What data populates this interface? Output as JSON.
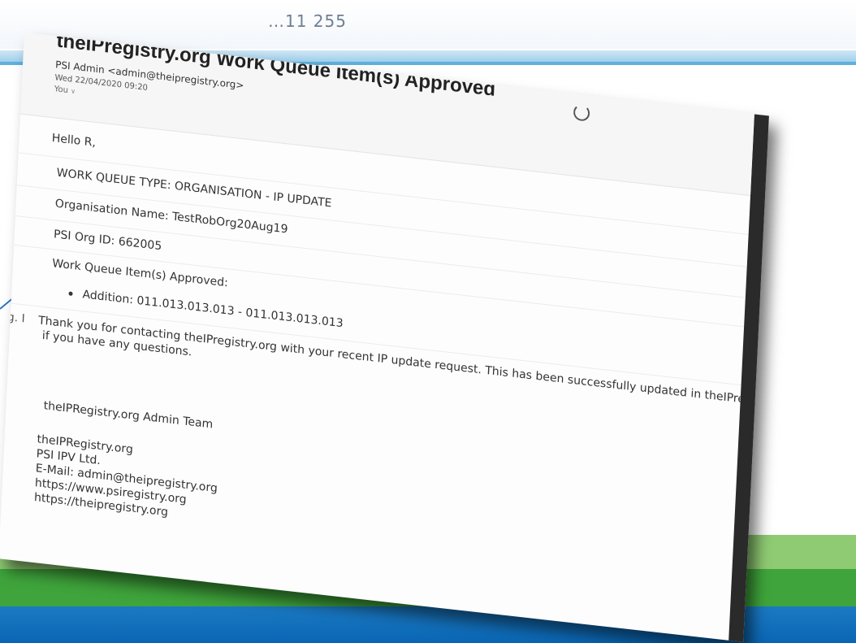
{
  "background": {
    "behind_title": "…11 255"
  },
  "email": {
    "subject": "theIPregistry.org Work Queue Item(s) Approved",
    "sender": "PSI Admin <admin@theipregistry.org>",
    "date": "Wed 22/04/2020 09:20",
    "recipient": "You",
    "greeting": "Hello R,",
    "queue_type": "WORK QUEUE TYPE: ORGANISATION - IP UPDATE",
    "org_name": "Organisation Name: TestRobOrg20Aug19",
    "org_id": "PSI Org ID: 662005",
    "approved_heading": "Work Queue Item(s) Approved:",
    "approved_items": [
      "Addition: 011.013.013.013 - 011.013.013.013"
    ],
    "cut_prefix": "g. I",
    "thank_you_line1": "Thank you for contacting theIPregistry.org with your recent IP update request. This has been successfully updated in theIPregistry.or",
    "thank_you_line2": "if you have any questions.",
    "signoff": "theIPRegistry.org Admin Team",
    "signature": {
      "org": "theIPRegistry.org",
      "company": "PSI IPV Ltd.",
      "email": "E-Mail: admin@theipregistry.org",
      "url1": "https://www.psiregistry.org",
      "url2": "https://theipregistry.org"
    }
  },
  "colors": {
    "band_light_green": "#8fcb73",
    "band_green": "#3fa43b",
    "band_blue": "#0a66b4",
    "top_line_blue": "#9fd0ec"
  }
}
